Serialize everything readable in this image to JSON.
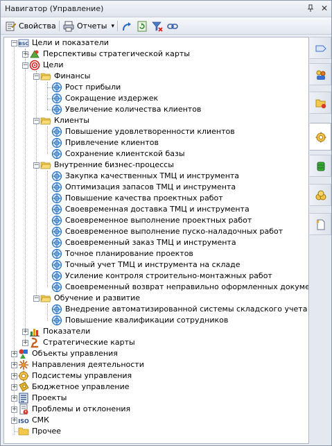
{
  "window": {
    "title": "Навигатор (Управление)",
    "pin_glyph": "▾ ⊥",
    "close_glyph": "✕"
  },
  "toolbar": {
    "properties_label": "Свойства",
    "reports_label": "Отчеты",
    "reports_arrow": "▾",
    "icons": [
      "properties-icon",
      "reports-icon",
      "navigate-icon",
      "refresh-icon",
      "filter-clear-icon",
      "link-icon"
    ]
  },
  "tree": {
    "root": "Цели и показатели",
    "root_badge": "BSC",
    "perspectives": "Перспективы стратегической карты",
    "goals": "Цели",
    "finance": {
      "label": "Финансы",
      "items": [
        "Рост прибыли",
        "Сокращение издержек",
        "Увеличение количества клиентов"
      ]
    },
    "clients": {
      "label": "Клиенты",
      "items": [
        "Повышение удовлетворенности клиентов",
        "Привлечение клиентов",
        "Сохранение клиентской базы"
      ]
    },
    "internal": {
      "label": "Внутренние бизнес-процессы",
      "items": [
        "Закупка качественных ТМЦ и инструмента",
        "Оптимизация запасов ТМЦ и инструмента",
        "Повышение качества проектных работ",
        "Своевременная доставка ТМЦ и инструмента",
        "Своевременное выполнение проектных работ",
        "Своевременное выполнение пуско-наладочных работ",
        "Своевременный заказ ТМЦ и инструмента",
        "Точное планирование проектов",
        "Точный учет ТМЦ и инструмента на складе",
        "Усиление контроля строительно-монтажных работ",
        "Своевременный возврат неправильно оформленных документов"
      ]
    },
    "learning": {
      "label": "Обучение и развитие",
      "items": [
        "Внедрение автоматизированной системы складского учета",
        "Повышение квалификации сотрудников"
      ]
    },
    "indicators": "Показатели",
    "strategy_maps": "Стратегические карты",
    "top_level": [
      "Объекты управления",
      "Направления деятельности",
      "Подсистемы управления",
      "Бюджетное управление",
      "Проекты",
      "Проблемы и отклонения",
      "СМК",
      "Прочее"
    ],
    "smk_badge": "ISO"
  },
  "sidebar": {
    "tabs": [
      "flow-tab-icon",
      "people-tab-icon",
      "folder-tab-icon",
      "goals-tab-icon",
      "database-tab-icon",
      "coins-tab-icon",
      "new-document-tab-icon"
    ],
    "active_index": 3
  },
  "colors": {
    "goal_icon": "#1f6fc5",
    "folder": "#f2c94c",
    "accent": "#3a6fd1"
  }
}
